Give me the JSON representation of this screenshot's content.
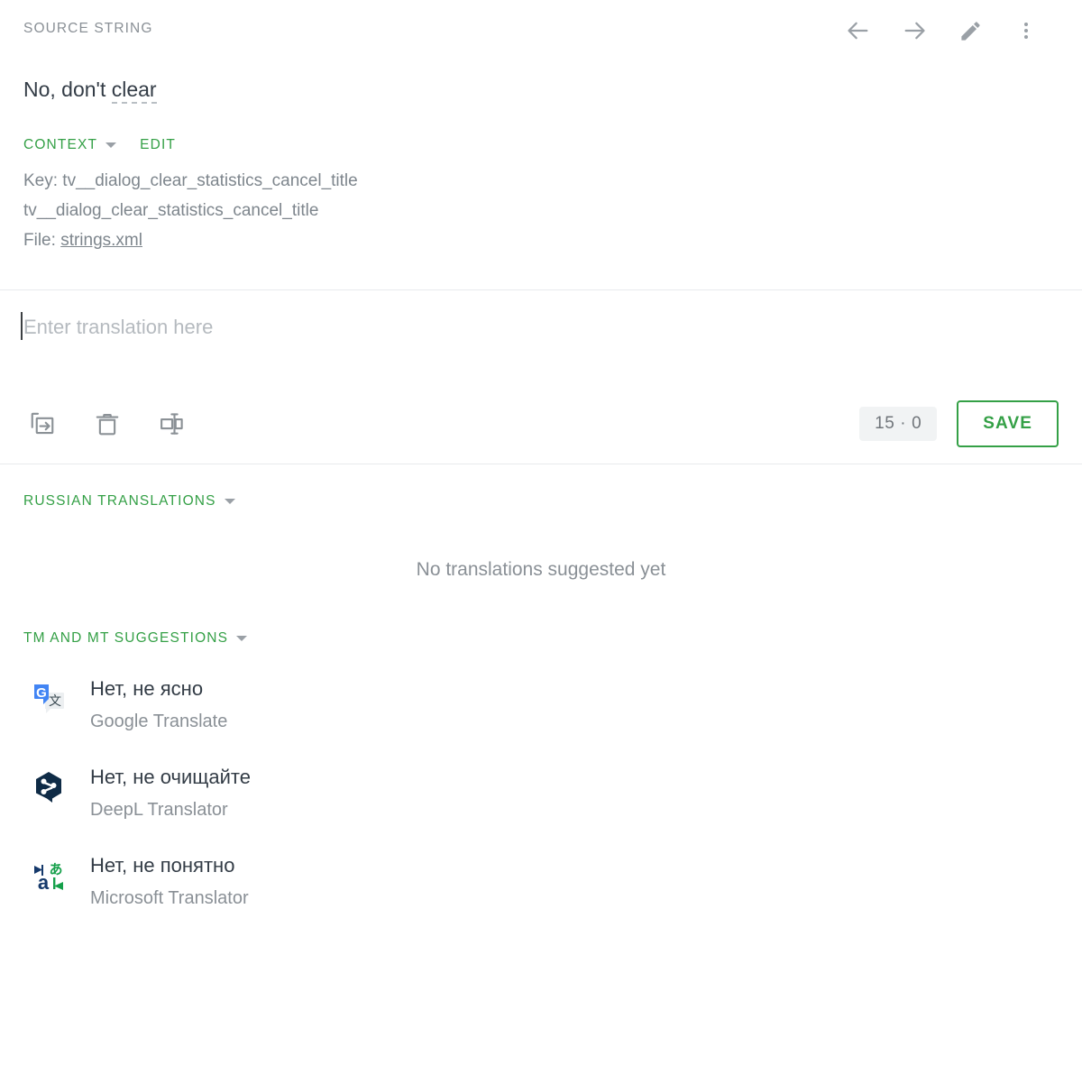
{
  "header": {
    "caption": "SOURCE STRING",
    "actions": [
      {
        "name": "previous-string",
        "icon": "arrow-left-icon"
      },
      {
        "name": "next-string",
        "icon": "arrow-right-icon"
      },
      {
        "name": "edit-source",
        "icon": "pencil-icon"
      },
      {
        "name": "more-options",
        "icon": "more-vertical-icon"
      }
    ]
  },
  "source": {
    "text_before": "No, don't ",
    "highlighted_term": "clear"
  },
  "context": {
    "toggle_label": "CONTEXT",
    "edit_label": "EDIT",
    "key_line": "Key: tv__dialog_clear_statistics_cancel_title",
    "id_line": "tv__dialog_clear_statistics_cancel_title",
    "file_label": "File: ",
    "file_name": "strings.xml"
  },
  "editor": {
    "placeholder": "Enter translation here",
    "value": "",
    "tools": [
      {
        "name": "copy-source-button",
        "icon": "copy-source-icon"
      },
      {
        "name": "clear-translation-button",
        "icon": "trash-icon"
      },
      {
        "name": "insert-special-character-button",
        "icon": "text-marker-icon"
      }
    ],
    "counter": "15 · 0",
    "save_label": "SAVE"
  },
  "translations_section": {
    "title": "RUSSIAN TRANSLATIONS",
    "empty_message": "No translations suggested yet"
  },
  "suggestions_section": {
    "title": "TM AND MT SUGGESTIONS",
    "items": [
      {
        "text": "Нет, не ясно",
        "provider": "Google Translate",
        "icon": "google-translate-icon"
      },
      {
        "text": "Нет, не очищайте",
        "provider": "DeepL Translator",
        "icon": "deepl-icon"
      },
      {
        "text": "Нет, не понятно",
        "provider": "Microsoft Translator",
        "icon": "microsoft-translator-icon"
      }
    ]
  },
  "colors": {
    "accent_green": "#34a046",
    "muted_text": "#8a9096",
    "primary_text": "#333c46",
    "divider": "#e8eaed",
    "badge_bg": "#f1f3f4"
  }
}
